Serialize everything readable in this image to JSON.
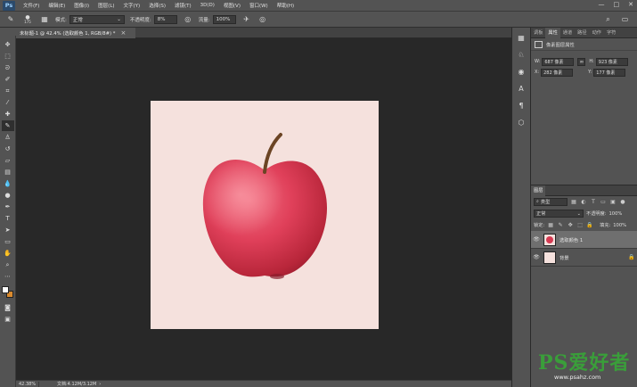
{
  "app": {
    "logo": "Ps"
  },
  "menu": [
    "文件(F)",
    "编辑(E)",
    "图像(I)",
    "图层(L)",
    "文字(Y)",
    "选择(S)",
    "滤镜(T)",
    "3D(D)",
    "视图(V)",
    "窗口(W)",
    "帮助(H)"
  ],
  "window_controls": {
    "minimize": "—",
    "maximize": "□",
    "close": "✕"
  },
  "options": {
    "brush_size": "175",
    "mode_label": "模式:",
    "mode_value": "正常",
    "opacity_label": "不透明度:",
    "opacity_value": "8%",
    "flow_label": "流量:",
    "flow_value": "100%"
  },
  "document": {
    "tab_title": "未标题-1 @ 42.4% (选取颜色 1, RGB/8#) *",
    "background_color": "#f5e1dd"
  },
  "status": {
    "zoom": "42.38%",
    "doc_size": "文档:4.12M/3.12M"
  },
  "panels": {
    "tabs": [
      "调板",
      "属性",
      "通道",
      "路径",
      "动作",
      "字符"
    ],
    "active_tab": "属性",
    "properties": {
      "title": "像素图层属性",
      "w_label": "W:",
      "w_value": "687 像素",
      "h_label": "H:",
      "h_value": "923 像素",
      "x_label": "X:",
      "x_value": "282 像素",
      "y_label": "Y:",
      "y_value": "177 像素"
    }
  },
  "layers_panel": {
    "tab": "图层",
    "filter_label": "类型",
    "blend_mode": "正常",
    "opacity_label": "不透明度:",
    "opacity_value": "100%",
    "lock_label": "锁定:",
    "fill_label": "填充:",
    "fill_value": "100%",
    "layers": [
      {
        "name": "选取颜色 1",
        "selected": true
      },
      {
        "name": "背景",
        "selected": false
      }
    ]
  },
  "watermark": {
    "big": "PS爱好者",
    "small": "www.psahz.com"
  },
  "colors": {
    "foreground": "#ffffff",
    "background": "#d98a2e",
    "accent_green": "#3a9e3a"
  }
}
